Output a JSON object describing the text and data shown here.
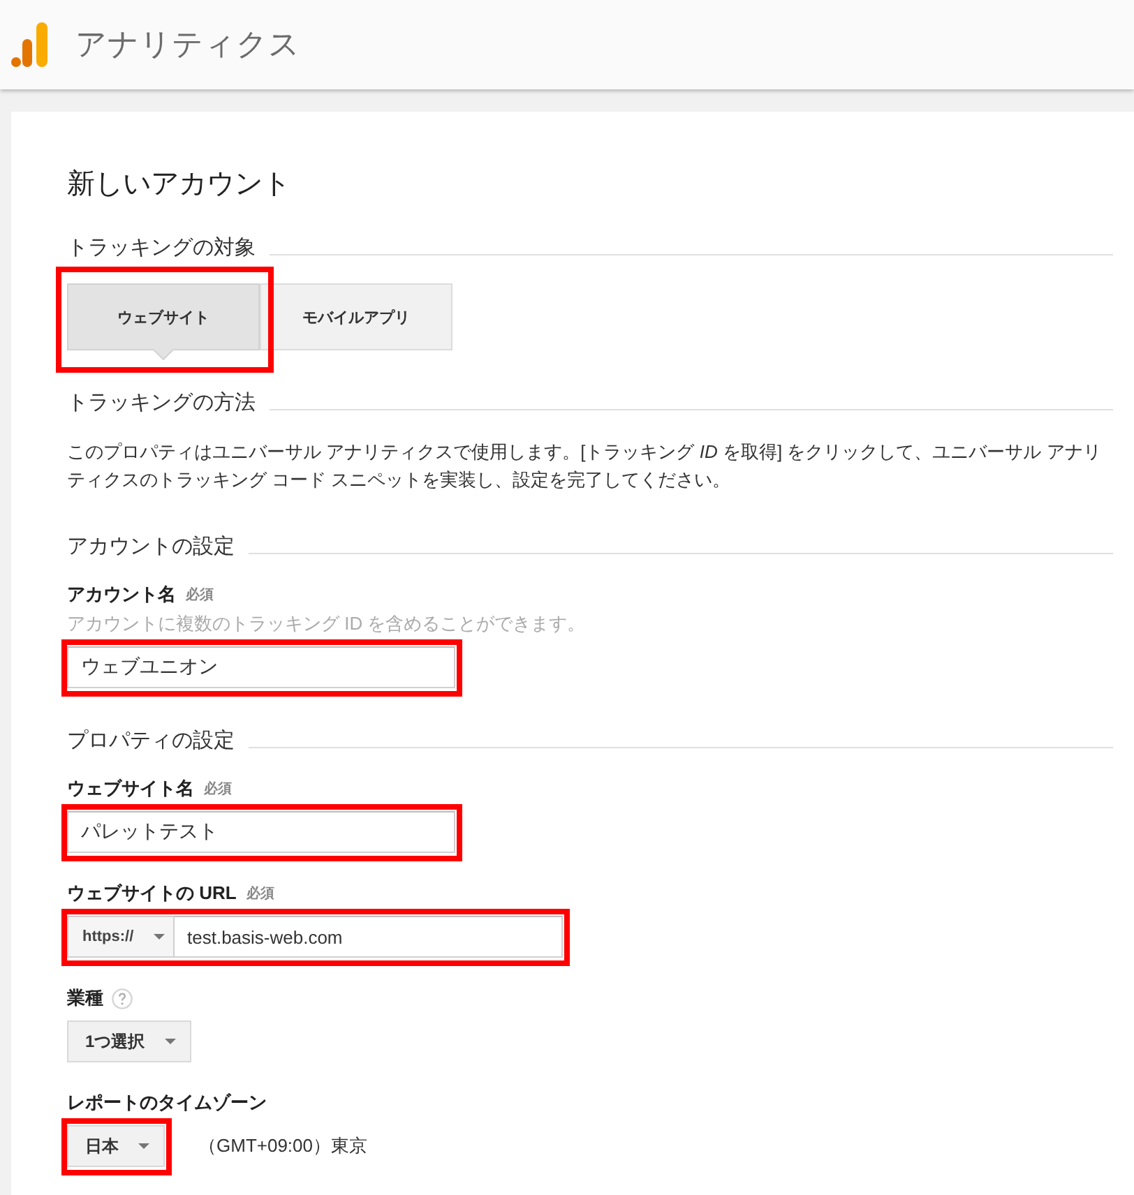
{
  "header": {
    "title": "アナリティクス"
  },
  "page": {
    "title": "新しいアカウント"
  },
  "sections": [
    {
      "heading": "トラッキングの対象",
      "kind": "toggle",
      "options": [
        {
          "label": "ウェブサイト",
          "selected": true,
          "highlighted": true
        },
        {
          "label": "モバイルアプリ",
          "selected": false,
          "highlighted": false
        }
      ]
    },
    {
      "heading": "トラッキングの方法",
      "kind": "text",
      "text": "このプロパティはユニバーサル アナリティクスで使用します。[トラッキング *ID* を取得] をクリックして、ユニバーサル アナリティクスのトラッキング コード スニペットを実装し、設定を完了してください。"
    },
    {
      "heading": "アカウントの設定",
      "kind": "fields",
      "fields": [
        {
          "kind": "text",
          "label": "アカウント名",
          "required_mark": "必須",
          "help": false,
          "hint": "アカウントに複数のトラッキング ID を含めることができます。",
          "value": "ウェブユニオン",
          "highlighted": true
        }
      ]
    },
    {
      "heading": "プロパティの設定",
      "kind": "fields",
      "fields": [
        {
          "kind": "text",
          "label": "ウェブサイト名",
          "required_mark": "必須",
          "help": false,
          "value": "パレットテスト",
          "highlighted": true
        },
        {
          "kind": "url",
          "label": "ウェブサイトの URL",
          "required_mark": "必須",
          "help": false,
          "protocol": "https://",
          "value": "test.basis-web.com",
          "highlighted": true
        },
        {
          "kind": "select",
          "label": "業種",
          "help": true,
          "value": "1つ選択",
          "highlighted": false
        },
        {
          "kind": "select",
          "label": "レポートのタイムゾーン",
          "help": false,
          "value": "日本",
          "note": "（GMT+09:00）東京",
          "highlighted": true
        }
      ]
    }
  ]
}
